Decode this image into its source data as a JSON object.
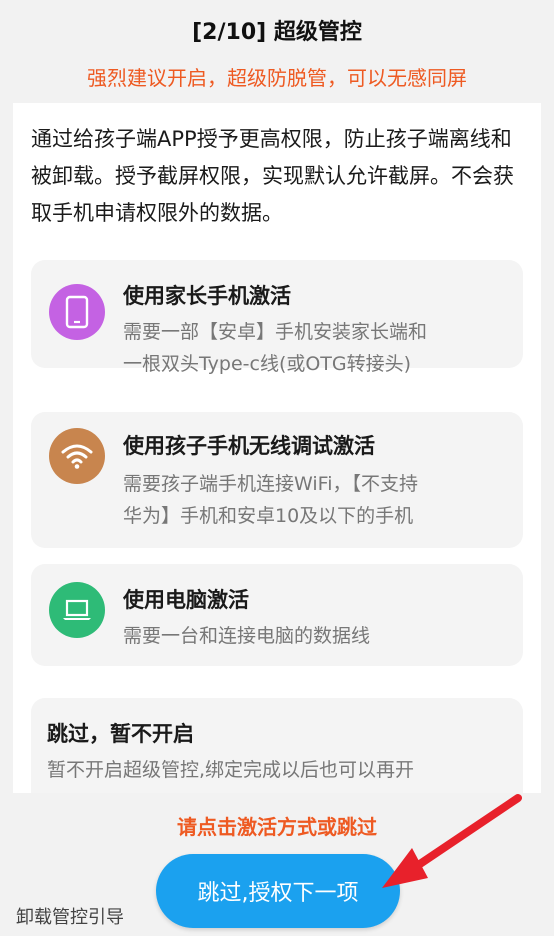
{
  "header": {
    "title": "[2/10] 超级管控",
    "subtitle": "强烈建议开启，超级防脱管，可以无感同屏"
  },
  "intro": "通过给孩子端APP授予更高权限，防止孩子端离线和被卸载。授予截屏权限，实现默认允许截屏。不会获取手机申请权限外的数据。",
  "options": [
    {
      "title": "使用家长手机激活",
      "desc_line1": "需要一部【安卓】手机安装家长端和",
      "desc_line2": "一根双头Type-c线(或OTG转接头)",
      "icon": "phone-icon",
      "color": "#c462e3"
    },
    {
      "title": "使用孩子手机无线调试激活",
      "desc_line1": "需要孩子端手机连接WiFi，【不支持",
      "desc_line2": "华为】手机和安卓10及以下的手机",
      "icon": "wifi-icon",
      "color": "#c8854e"
    },
    {
      "title": "使用电脑激活",
      "desc_line1": "需要一台和连接电脑的数据线",
      "icon": "laptop-icon",
      "color": "#2ebb77"
    }
  ],
  "skip_option": {
    "title": "跳过，暂不开启",
    "desc": "暂不开启超级管控,绑定完成以后也可以再开"
  },
  "hint": "请点击激活方式或跳过",
  "uninstall_label": "卸载管控引导",
  "main_button": "跳过,授权下一项",
  "colors": {
    "accent_orange": "#ee5a22",
    "button_blue": "#1ba1ef",
    "arrow_red": "#e8212b"
  }
}
